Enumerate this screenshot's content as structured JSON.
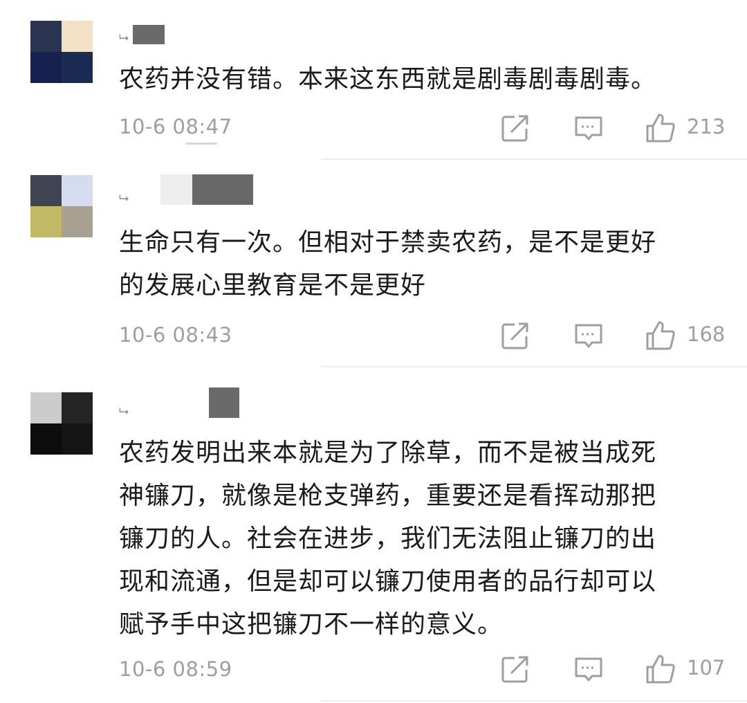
{
  "comments": [
    {
      "text": "农药并没有错。本来这东西就是剧毒剧毒剧毒。",
      "time": "10-6 08:47",
      "likes": "213",
      "avatar_colors": [
        "#2a3450",
        "#f2e1c6",
        "#17214f",
        "#1b2c54"
      ]
    },
    {
      "text": "生命只有一次。但相对于禁卖农药，是不是更好\n的发展心里教育是不是更好",
      "time": "10-6 08:43",
      "likes": "168",
      "avatar_colors": [
        "#3e4452",
        "#d6dcef",
        "#c2b865",
        "#a8a191"
      ]
    },
    {
      "text": "农药发明出来本就是为了除草，而不是被当成死\n神镰刀，就像是枪支弹药，重要还是看挥动那把\n镰刀的人。社会在进步，我们无法阻止镰刀的出\n现和流通，但是却可以镰刀使用者的品行却可以\n赋予手中这把镰刀不一样的意义。",
      "time": "10-6 08:59",
      "likes": "107",
      "avatar_colors": [
        "#cccccc",
        "#252525",
        "#0c0c0c",
        "#151515"
      ]
    }
  ],
  "icons": {
    "share": "share-icon",
    "comment": "comment-icon",
    "like": "thumbs-up-icon"
  },
  "colors": {
    "text": "#1a1a1a",
    "meta": "#9e9e9e",
    "divider": "#ececec"
  }
}
